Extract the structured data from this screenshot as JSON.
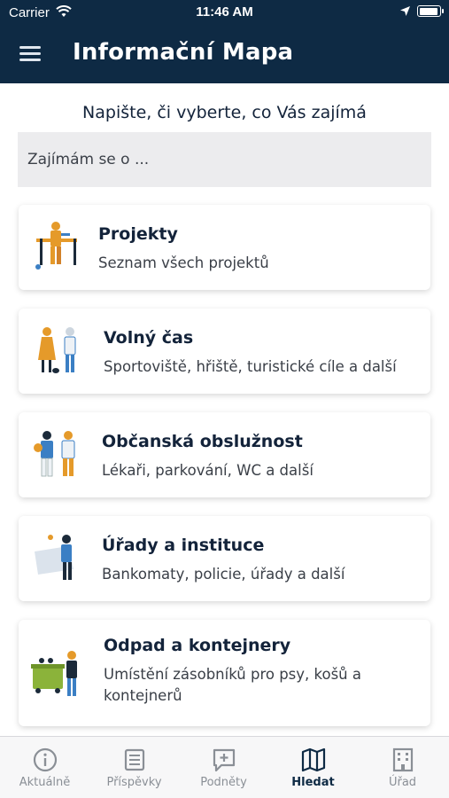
{
  "status_bar": {
    "carrier": "Carrier",
    "time": "11:46 AM"
  },
  "header": {
    "title": "Informační Mapa",
    "menu_icon": "hamburger-menu-icon"
  },
  "search": {
    "prompt": "Napište, či vyberte, co Vás zajímá",
    "placeholder": "Zajímám se o ..."
  },
  "categories": [
    {
      "title": "Projekty",
      "subtitle": "Seznam všech projektů",
      "icon": "construction-worker-illustration"
    },
    {
      "title": "Volný čas",
      "subtitle": "Sportoviště, hřiště, turistické cíle a další",
      "icon": "people-leisure-illustration"
    },
    {
      "title": "Občanská obslužnost",
      "subtitle": "Lékaři, parkování, WC a další",
      "icon": "people-talking-illustration"
    },
    {
      "title": "Úřady a instituce",
      "subtitle": "Bankomaty, policie, úřady a další",
      "icon": "office-desk-illustration"
    },
    {
      "title": "Odpad a kontejnery",
      "subtitle": "Umístění zásobníků pro psy, košů a kontejnerů",
      "icon": "waste-container-illustration"
    }
  ],
  "tabs": [
    {
      "label": "Aktuálně",
      "icon": "info-icon",
      "active": false
    },
    {
      "label": "Příspěvky",
      "icon": "document-icon",
      "active": false
    },
    {
      "label": "Podněty",
      "icon": "add-comment-icon",
      "active": false
    },
    {
      "label": "Hledat",
      "icon": "map-icon",
      "active": true
    },
    {
      "label": "Úřad",
      "icon": "building-icon",
      "active": false
    }
  ],
  "colors": {
    "header_bg": "#0e2a44",
    "active_tab": "#0e2a44",
    "inactive_tab": "#8a8f96",
    "accent_orange": "#e59a2a",
    "accent_blue": "#3b7fc4"
  }
}
